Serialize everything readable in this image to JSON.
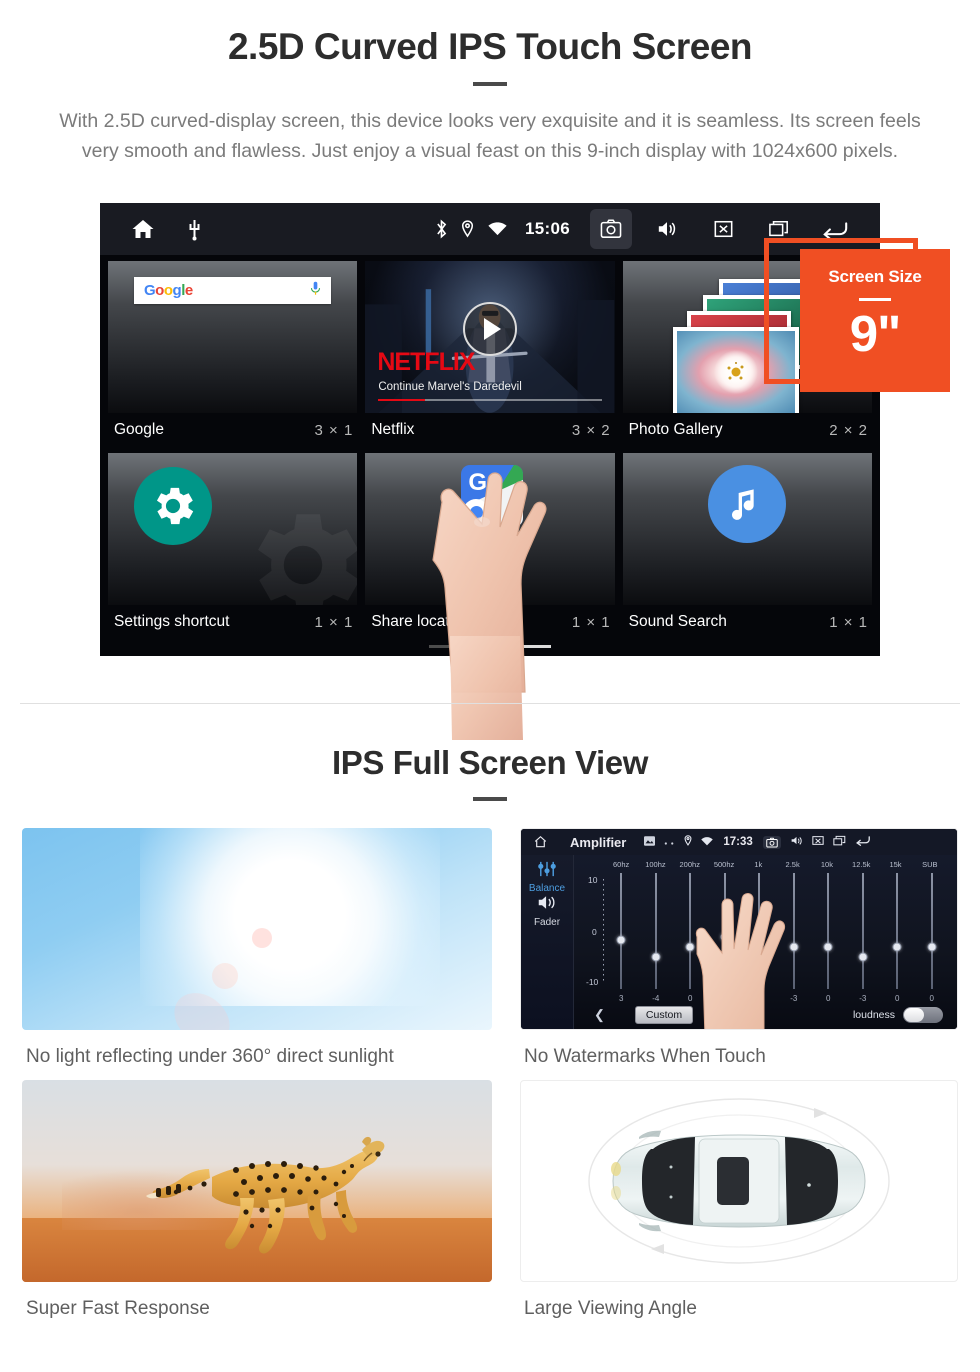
{
  "section1": {
    "title": "2.5D Curved IPS Touch Screen",
    "description": "With 2.5D curved-display screen, this device looks very exquisite and it is seamless. Its screen feels very smooth and flawless. Just enjoy a visual feast on this 9-inch display with 1024x600 pixels."
  },
  "badge": {
    "label": "Screen Size",
    "value": "9\"",
    "color": "#f04f23"
  },
  "device": {
    "statusbar": {
      "home_icon": "home-icon",
      "usb_icon": "usb-icon",
      "bluetooth_icon": "bluetooth-icon",
      "location_icon": "location-pin-icon",
      "wifi_icon": "wifi-icon",
      "time": "15:06",
      "camera_icon": "camera-icon",
      "volume_icon": "volume-icon",
      "close_icon": "close-box-icon",
      "recents_icon": "recents-icon",
      "back_icon": "back-arrow-icon"
    },
    "widgets": [
      {
        "name": "Google",
        "size": "3 × 1",
        "icon": "google-search-widget",
        "search_placeholder": "",
        "logo": "Google",
        "mic_icon": "microphone-icon"
      },
      {
        "name": "Netflix",
        "size": "3 × 2",
        "icon": "netflix-widget",
        "brand": "NETFLIX",
        "subtitle": "Continue Marvel's Daredevil",
        "play_icon": "play-icon"
      },
      {
        "name": "Photo Gallery",
        "size": "2 × 2",
        "icon": "photo-gallery-widget"
      },
      {
        "name": "Settings shortcut",
        "size": "1 × 1",
        "icon": "gear-icon"
      },
      {
        "name": "Share location",
        "size": "1 × 1",
        "icon": "google-maps-icon"
      },
      {
        "name": "Sound Search",
        "size": "1 × 1",
        "icon": "music-note-icon"
      }
    ],
    "pagination": {
      "pages": 3,
      "active": 3
    }
  },
  "section2": {
    "title": "IPS Full Screen View",
    "cards": [
      {
        "caption": "No light reflecting under 360° direct sunlight",
        "image": "blue-sky-sun-flare"
      },
      {
        "caption": "No Watermarks When Touch",
        "image": "amplifier-equalizer-screen"
      },
      {
        "caption": "Super Fast Response",
        "image": "running-cheetah"
      },
      {
        "caption": "Large Viewing Angle",
        "image": "car-top-view-360"
      }
    ]
  },
  "amplifier": {
    "title": "Amplifier",
    "time": "17:33",
    "side": {
      "balance_label": "Balance",
      "balance_icon": "sliders-icon",
      "fader_label": "Fader",
      "fader_icon": "speaker-icon"
    },
    "scale": {
      "top": "10",
      "bottom": "0",
      "lower": "-10"
    },
    "bands": [
      "60hz",
      "100hz",
      "200hz",
      "500hz",
      "1k",
      "2.5k",
      "10k",
      "12.5k",
      "15k",
      "SUB"
    ],
    "values": [
      "3",
      "-4",
      "0",
      "0",
      "0",
      "-3",
      "0",
      "-3",
      "0",
      "0"
    ],
    "preset_label": "Custom",
    "loudness_label": "loudness",
    "loudness_on": false,
    "back_icon": "left-arrow-icon",
    "statusbar_icons": [
      "picture-icon",
      "dots-icon",
      "location-pin-icon",
      "wifi-icon",
      "camera-icon",
      "volume-icon",
      "close-box-icon",
      "recents-icon",
      "back-arrow-icon"
    ]
  }
}
